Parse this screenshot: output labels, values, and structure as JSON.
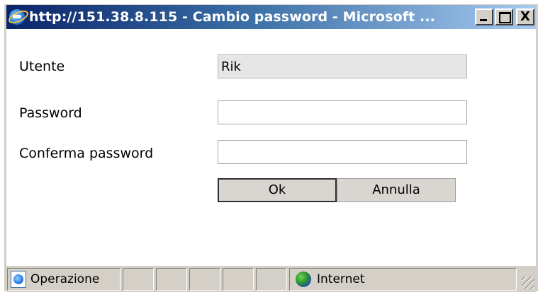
{
  "window": {
    "title": "http://151.38.8.115 - Cambio password - Microsoft ...",
    "title_icon": "ie-icon",
    "controls": {
      "minimize": "minimize-icon",
      "maximize": "maximize-icon",
      "close_label": "X"
    }
  },
  "form": {
    "user_label": "Utente",
    "user_value": "Rik",
    "password_label": "Password",
    "password_value": "",
    "confirm_label": "Conferma password",
    "confirm_value": ""
  },
  "buttons": {
    "ok_label": "Ok",
    "cancel_label": "Annulla"
  },
  "statusbar": {
    "status_text": "Operazione",
    "zone_text": "Internet",
    "page_icon": "page-ie-icon",
    "zone_icon": "globe-icon"
  },
  "colors": {
    "titlebar_start": "#0a246a",
    "titlebar_end": "#a6caf0",
    "chrome": "#d4d0c8"
  }
}
